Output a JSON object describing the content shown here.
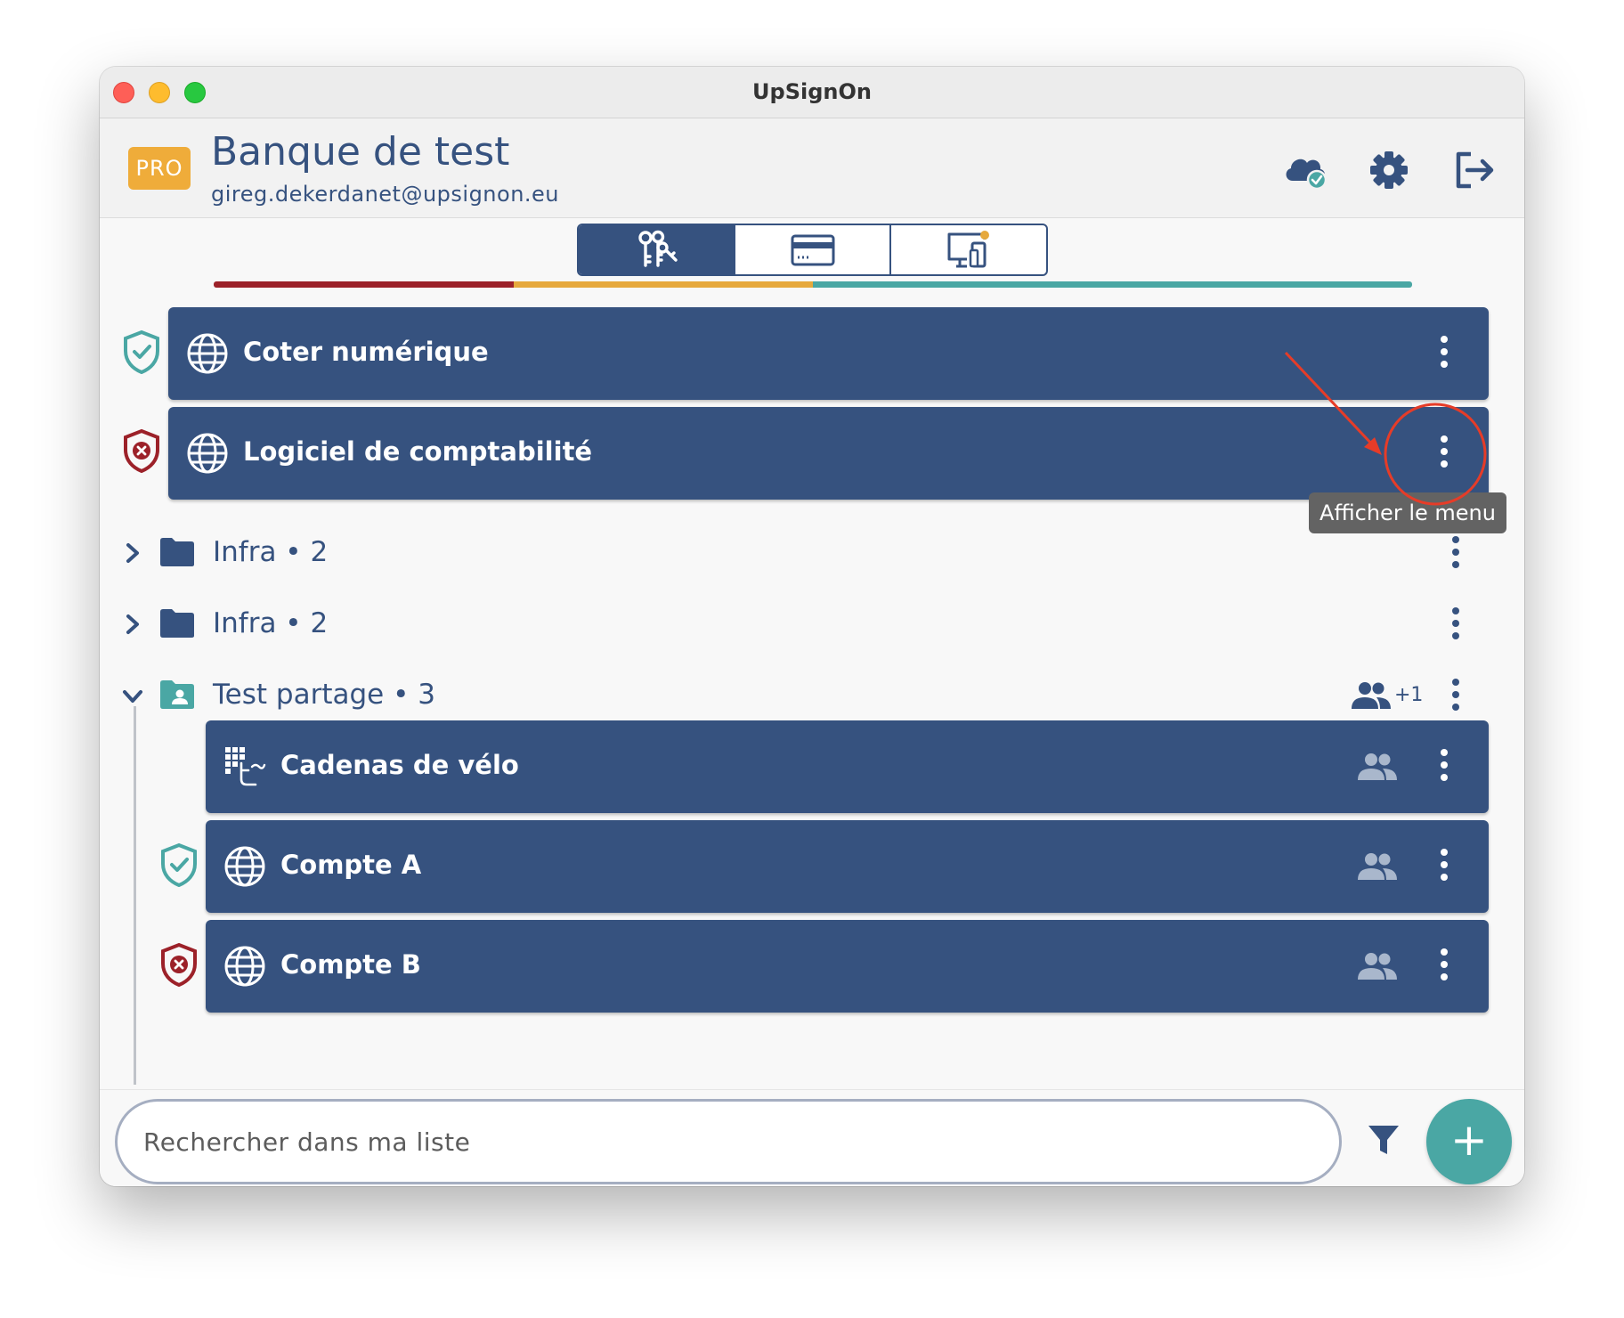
{
  "window": {
    "title": "UpSignOn"
  },
  "header": {
    "badge": "PRO",
    "bank_name": "Banque de test",
    "email": "gireg.dekerdanet@upsignon.eu",
    "icons": [
      "cloud-sync-icon",
      "gear-icon",
      "logout-icon"
    ]
  },
  "tabs": [
    {
      "icon": "keys-icon",
      "active": true
    },
    {
      "icon": "credit-card-icon",
      "active": false
    },
    {
      "icon": "devices-icon",
      "active": false,
      "notification": true
    }
  ],
  "strength_bar": {
    "segments": [
      {
        "level": "weak",
        "color": "#9c2129",
        "fraction": 0.25
      },
      {
        "level": "medium",
        "color": "#e6a93d",
        "fraction": 0.25
      },
      {
        "level": "strong",
        "color": "#4aa7a4",
        "fraction": 0.5
      }
    ]
  },
  "items": {
    "coter": {
      "label": "Coter numérique",
      "security": "safe",
      "icon": "globe-icon"
    },
    "logiciel": {
      "label": "Logiciel de comptabilité",
      "security": "unsafe",
      "icon": "globe-icon"
    },
    "cadenas": {
      "label": "Cadenas de vélo",
      "icon": "keypad-code-icon",
      "shared": true
    },
    "compte_a": {
      "label": "Compte A",
      "security": "safe",
      "icon": "globe-icon",
      "shared": true
    },
    "compte_b": {
      "label": "Compte B",
      "security": "unsafe",
      "icon": "globe-icon",
      "shared": true
    }
  },
  "folders": {
    "infra1": {
      "label": "Infra • 2",
      "expanded": false
    },
    "infra2": {
      "label": "Infra • 2",
      "expanded": false
    },
    "test_partage": {
      "label": "Test partage • 3",
      "expanded": true,
      "shared": true,
      "extra_users": "+1"
    }
  },
  "tooltip": {
    "text": "Afficher le menu"
  },
  "search": {
    "placeholder": "Rechercher dans ma liste"
  },
  "add_button": {
    "label": "+"
  },
  "colors": {
    "primary": "#36527f",
    "accent_teal": "#4aa7a4",
    "danger": "#9c2129",
    "pro_badge": "#efac3a",
    "annotation": "#e63c28"
  }
}
